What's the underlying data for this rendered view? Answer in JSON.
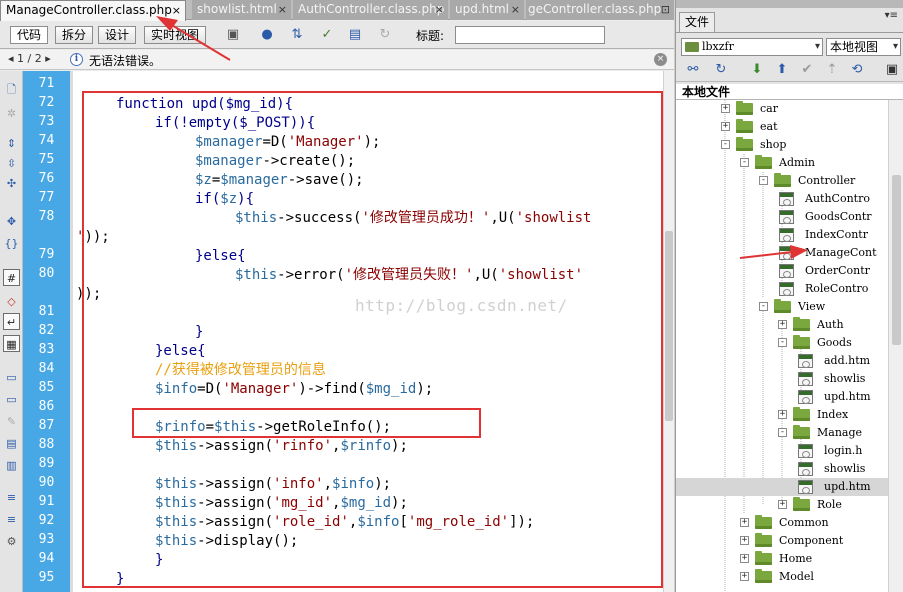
{
  "tabs": [
    {
      "label": "ManageController.class.php",
      "close": "×",
      "active": true
    },
    {
      "label": "showlist.html",
      "close": "×"
    },
    {
      "label": "AuthController.class.php",
      "close": "×"
    },
    {
      "label": "upd.html",
      "close": "×"
    },
    {
      "label": "geController.class.php",
      "close": "⊡"
    }
  ],
  "toolbar": {
    "code": "代码",
    "split": "拆分",
    "design": "设计",
    "live": "实时视图",
    "title_label": "标题:",
    "title_value": ""
  },
  "infobar": {
    "pager": "◂  1 / 2  ▸",
    "message": "无语法错误。",
    "info_glyph": "i",
    "close_glyph": "×"
  },
  "line_numbers": [
    "71",
    "72",
    "73",
    "74",
    "75",
    "76",
    "77",
    "78",
    "",
    "79",
    "80",
    "",
    "81",
    "82",
    "83",
    "84",
    "85",
    "86",
    "87",
    "88",
    "89",
    "90",
    "91",
    "92",
    "93",
    "94",
    "95"
  ],
  "code": {
    "l72": "function upd($mg_id){",
    "l73": "if(!empty($_POST)){",
    "l74_a": "$manager",
    "l74_b": "=D(",
    "l74_c": "'Manager'",
    "l74_d": ");",
    "l75_a": "$manager",
    "l75_b": "->create();",
    "l76_a": "$z",
    "l76_b": "=",
    "l76_c": "$manager",
    "l76_d": "->save();",
    "l77_a": "if(",
    "l77_b": "$z",
    "l77_c": "){",
    "l78_a": "$this",
    "l78_b": "->success(",
    "l78_c": "'修改管理员成功！'",
    "l78_d": ",U(",
    "l78_e": "'showlist",
    "l78w_a": "'",
    "l78w_b": "));",
    "l79": "}else{",
    "l80_a": "$this",
    "l80_b": "->error(",
    "l80_c": "'修改管理员失败！'",
    "l80_d": ",U(",
    "l80_e": "'showlist'",
    "l80w": "));",
    "l82": "}",
    "l83": "}else{",
    "l84": "//获得被修改管理员的信息",
    "l85_a": "$info",
    "l85_b": "=D(",
    "l85_c": "'Manager'",
    "l85_d": ")->find(",
    "l85_e": "$mg_id",
    "l85_f": ");",
    "l87_a": "$rinfo",
    "l87_b": "=",
    "l87_c": "$this",
    "l87_d": "->getRoleInfo();",
    "l88_a": "$this",
    "l88_b": "->assign(",
    "l88_c": "'rinfo'",
    "l88_d": ",",
    "l88_e": "$rinfo",
    "l88_f": ");",
    "l90_a": "$this",
    "l90_b": "->assign(",
    "l90_c": "'info'",
    "l90_d": ",",
    "l90_e": "$info",
    "l90_f": ");",
    "l91_a": "$this",
    "l91_b": "->assign(",
    "l91_c": "'mg_id'",
    "l91_d": ",",
    "l91_e": "$mg_id",
    "l91_f": ");",
    "l92_a": "$this",
    "l92_b": "->assign(",
    "l92_c": "'role_id'",
    "l92_d": ",",
    "l92_e": "$info",
    "l92_f": "[",
    "l92_g": "'mg_role_id'",
    "l92_h": "]);",
    "l93_a": "$this",
    "l93_b": "->display();",
    "l94": "}",
    "l95": "}"
  },
  "watermark": "http://blog.csdn.net/",
  "files_panel": {
    "tab": "文件",
    "menu_glyph": "▾≡",
    "site": "lbxzfr",
    "view": "本地视图",
    "dropdown_glyph": "▾",
    "tree_header": "本地文件",
    "tree": [
      {
        "label": "car",
        "type": "folder",
        "toggle": "+"
      },
      {
        "label": "eat",
        "type": "folder",
        "toggle": "+"
      },
      {
        "label": "shop",
        "type": "folder",
        "toggle": "-"
      },
      {
        "label": "Admin",
        "type": "folder",
        "toggle": "-"
      },
      {
        "label": "Controller",
        "type": "folder",
        "toggle": "-"
      },
      {
        "label": "AuthContro",
        "type": "file"
      },
      {
        "label": "GoodsContr",
        "type": "file"
      },
      {
        "label": "IndexContr",
        "type": "file"
      },
      {
        "label": "ManageCont",
        "type": "file"
      },
      {
        "label": "OrderContr",
        "type": "file"
      },
      {
        "label": "RoleContro",
        "type": "file"
      },
      {
        "label": "View",
        "type": "folder",
        "toggle": "-"
      },
      {
        "label": "Auth",
        "type": "folder",
        "toggle": "+"
      },
      {
        "label": "Goods",
        "type": "folder",
        "toggle": "-"
      },
      {
        "label": "add.htm",
        "type": "file"
      },
      {
        "label": "showlis",
        "type": "file"
      },
      {
        "label": "upd.htm",
        "type": "file"
      },
      {
        "label": "Index",
        "type": "folder",
        "toggle": "+"
      },
      {
        "label": "Manage",
        "type": "folder",
        "toggle": "-"
      },
      {
        "label": "login.h",
        "type": "file"
      },
      {
        "label": "showlis",
        "type": "file"
      },
      {
        "label": "upd.htm",
        "type": "file",
        "selected": true
      },
      {
        "label": "Role",
        "type": "folder",
        "toggle": "+"
      },
      {
        "label": "Common",
        "type": "folder",
        "toggle": "+"
      },
      {
        "label": "Component",
        "type": "folder",
        "toggle": "+"
      },
      {
        "label": "Home",
        "type": "folder",
        "toggle": "+"
      },
      {
        "label": "Model",
        "type": "folder",
        "toggle": "+"
      }
    ]
  },
  "colors": {
    "gutter": "#47a8e5",
    "annotation_red": "#e03333",
    "keyword": "#00008b",
    "variable": "#2a6b9f",
    "string": "#8b0000",
    "comment": "#e8a010"
  }
}
